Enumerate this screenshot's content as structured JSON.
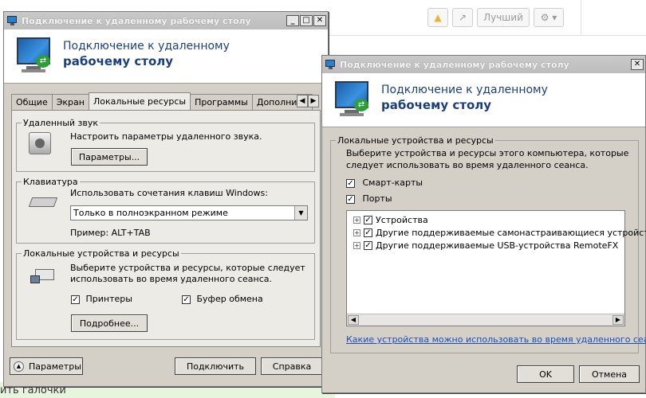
{
  "background": {
    "toolbar": {
      "warning_icon": "warning-icon",
      "share_icon": "share-icon",
      "best_label": "Лучший",
      "gear_icon": "gear-icon"
    },
    "bottom_text": "ить галочки"
  },
  "dialog1": {
    "title": "Подключение к удаленному рабочему столу",
    "banner_line1": "Подключение к удаленному",
    "banner_line2": "рабочему столу",
    "tabs": [
      "Общие",
      "Экран",
      "Локальные ресурсы",
      "Программы",
      "Дополнительно"
    ],
    "active_tab": "Локальные ресурсы",
    "sound": {
      "legend": "Удаленный звук",
      "description": "Настроить параметры удаленного звука.",
      "button": "Параметры..."
    },
    "keyboard": {
      "legend": "Клавиатура",
      "description": "Использовать сочетания клавиш Windows:",
      "combo_value": "Только в полноэкранном режиме",
      "example": "Пример: ALT+TAB"
    },
    "local": {
      "legend": "Локальные устройства и ресурсы",
      "description_line1": "Выберите устройства и ресурсы, которые следует",
      "description_line2": "использовать во время удаленного сеанса.",
      "printers_label": "Принтеры",
      "printers_checked": true,
      "clipboard_label": "Буфер обмена",
      "clipboard_checked": true,
      "more_button": "Подробнее..."
    },
    "footer": {
      "options_button": "Параметры",
      "connect_button": "Подключить",
      "help_button": "Справка"
    }
  },
  "dialog2": {
    "title": "Подключение к удаленному рабочему столу",
    "banner_line1": "Подключение к удаленному",
    "banner_line2": "рабочему столу",
    "group": {
      "legend": "Локальные устройства и ресурсы",
      "description_line1": "Выберите устройства и ресурсы этого компьютера, которые",
      "description_line2": "следует использовать во время удаленного сеанса.",
      "smartcards_label": "Смарт-карты",
      "ports_label": "Порты",
      "tree": [
        "Устройства",
        "Другие поддерживаемые самонастраивающиеся устройства",
        "Другие поддерживаемые USB-устройства RemoteFX"
      ],
      "link": "Какие устройства можно использовать во время удаленного сеанса?"
    },
    "footer": {
      "ok_button": "OK",
      "cancel_button": "Отмена"
    }
  }
}
